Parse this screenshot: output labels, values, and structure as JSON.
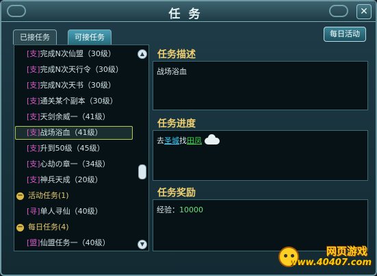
{
  "window": {
    "title": "任务"
  },
  "tabs": [
    {
      "label": "已接任务",
      "active": false
    },
    {
      "label": "可接任务",
      "active": true
    }
  ],
  "daily_button": {
    "label": "每日活动"
  },
  "task_list": {
    "items": [
      {
        "tag": "[支]",
        "name": "完成N次仙盟（30级）",
        "selected": false
      },
      {
        "tag": "[支]",
        "name": "完成N次天行令（30级）",
        "selected": false
      },
      {
        "tag": "[支]",
        "name": "完成N次天书（30级）",
        "selected": false
      },
      {
        "tag": "[支]",
        "name": "通关某个副本（30级）",
        "selected": false
      },
      {
        "tag": "[支]",
        "name": "天剑余威一（41级）",
        "selected": false
      },
      {
        "tag": "[支]",
        "name": "战场浴血（41级）",
        "selected": true
      },
      {
        "tag": "[支]",
        "name": "升到50级（45级）",
        "selected": false
      },
      {
        "tag": "[支]",
        "name": "心劫の章一（34级）",
        "selected": false
      },
      {
        "tag": "[支]",
        "name": "神兵天成（20级）",
        "selected": false
      }
    ],
    "groups": [
      {
        "label": "活动任务(1)",
        "items": [
          {
            "tag": "[寻]",
            "name": "单人寻仙（40级）"
          }
        ]
      },
      {
        "label": "每日任务(4)",
        "items": [
          {
            "tag": "[盟]",
            "name": "仙盟任务一（40级）"
          }
        ]
      }
    ],
    "scroll_up_icon": "up-arrow",
    "scroll_down_icon": "down-arrow"
  },
  "description": {
    "title": "任务描述",
    "text": "战场浴血"
  },
  "progress": {
    "title": "任务进度",
    "prefix": "去",
    "place": "圣城",
    "middle": "找",
    "npc": "田凤"
  },
  "reward": {
    "title": "任务奖励",
    "label": "经验：",
    "value": "10000"
  },
  "watermark": {
    "title": "网页游戏",
    "url": "www.40407.com"
  }
}
